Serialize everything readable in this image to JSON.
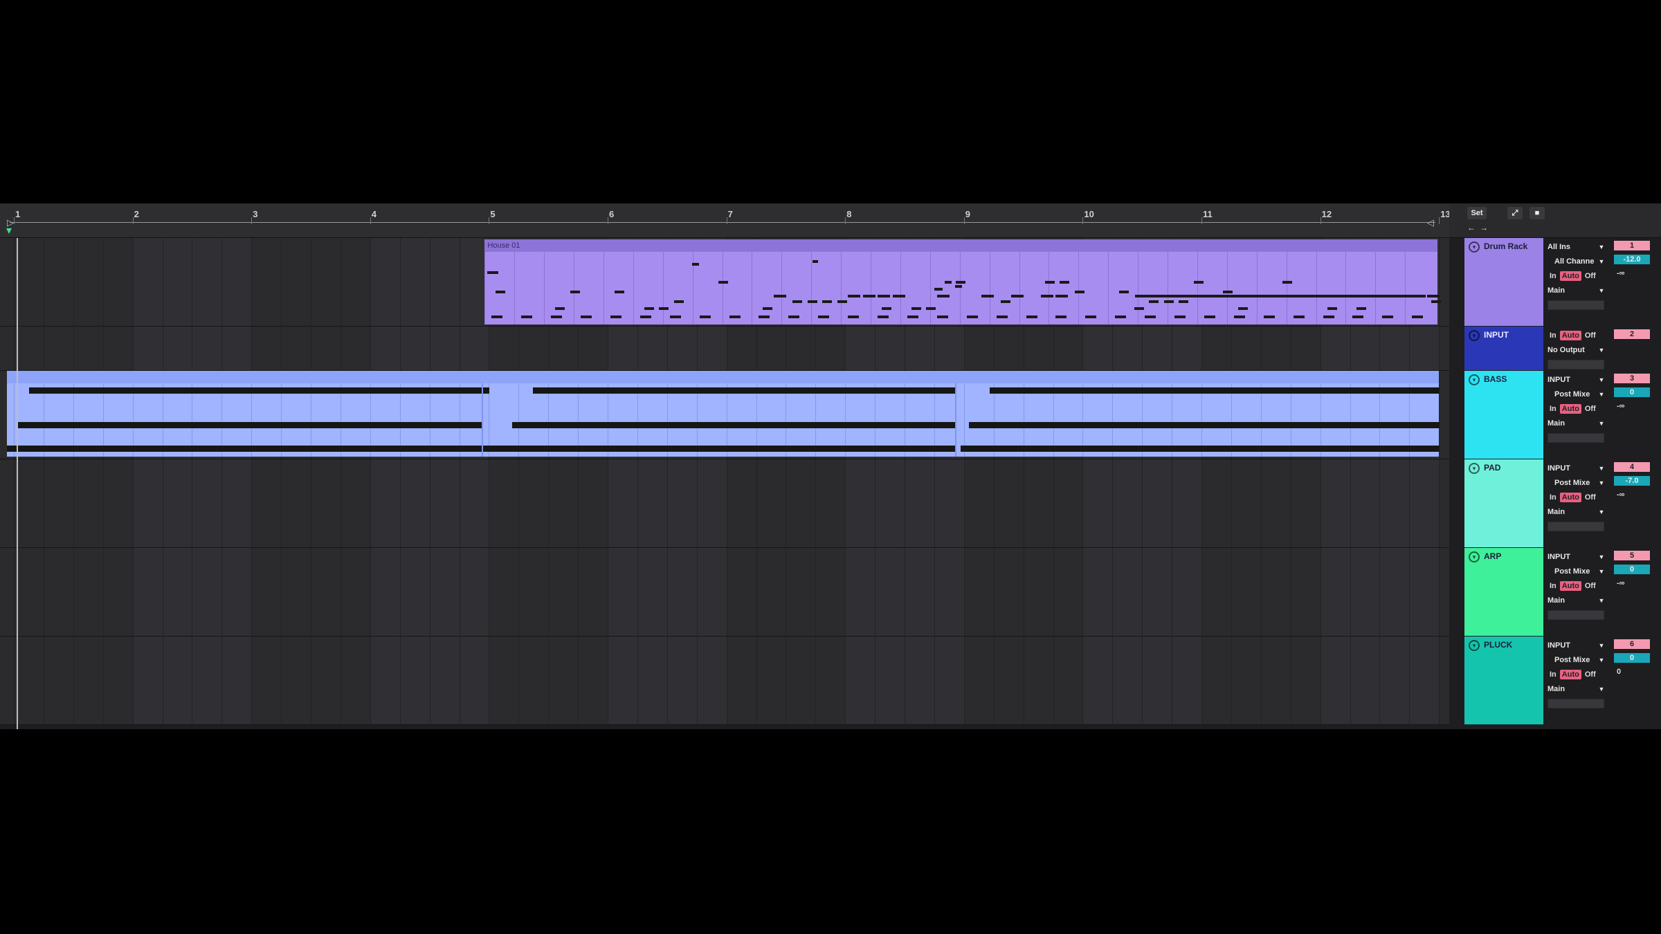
{
  "ruler": {
    "bars": [
      "1",
      "2",
      "3",
      "4",
      "5",
      "6",
      "7",
      "8",
      "9",
      "10",
      "11",
      "12",
      "13"
    ]
  },
  "controls": {
    "set_label": "Set",
    "expand_icon": "expand-icon",
    "lock_icon": "lock-icon",
    "left_arrow": "←",
    "right_arrow": "→"
  },
  "tracks": [
    {
      "name": "Drum Rack",
      "color": "#9b82e6",
      "clip_title": "House 01",
      "number": "1",
      "input_type": "All Ins",
      "input_channel": "All Channe",
      "monitor": [
        "In",
        "Auto",
        "Off"
      ],
      "output": "Main",
      "volume": "-12.0",
      "send": "-∞"
    },
    {
      "name": "INPUT",
      "color": "#2a38b8",
      "number": "2",
      "monitor": [
        "In",
        "Auto",
        "Off"
      ],
      "output": "No Output"
    },
    {
      "name": "BASS",
      "color": "#2de3f2",
      "number": "3",
      "input_type": "INPUT",
      "input_channel": "Post Mixe",
      "monitor": [
        "In",
        "Auto",
        "Off"
      ],
      "output": "Main",
      "volume": "0",
      "send": "-∞"
    },
    {
      "name": "PAD",
      "color": "#6ff0da",
      "number": "4",
      "input_type": "INPUT",
      "input_channel": "Post Mixe",
      "monitor": [
        "In",
        "Auto",
        "Off"
      ],
      "output": "Main",
      "volume": "-7.0",
      "send": "-∞"
    },
    {
      "name": "ARP",
      "color": "#3ff09a",
      "number": "5",
      "input_type": "INPUT",
      "input_channel": "Post Mixe",
      "monitor": [
        "In",
        "Auto",
        "Off"
      ],
      "output": "Main",
      "volume": "0",
      "send": "-∞"
    },
    {
      "name": "PLUCK",
      "color": "#15c4ac",
      "number": "6",
      "input_type": "INPUT",
      "input_channel": "Post Mixe",
      "monitor": [
        "In",
        "Auto",
        "Off"
      ],
      "output": "Main",
      "volume": "0",
      "send": "0"
    }
  ],
  "icons": {
    "fold": "fold-icon",
    "dropdown": "chevron-down-icon",
    "playhead": "playhead-marker-icon"
  },
  "colors": {
    "drum_clip": "#a88df0",
    "bass_clip": "#a0b4ff",
    "auto_button": "#e86080",
    "track_number": "#f39ab0",
    "volume": "#1aa7b8"
  }
}
